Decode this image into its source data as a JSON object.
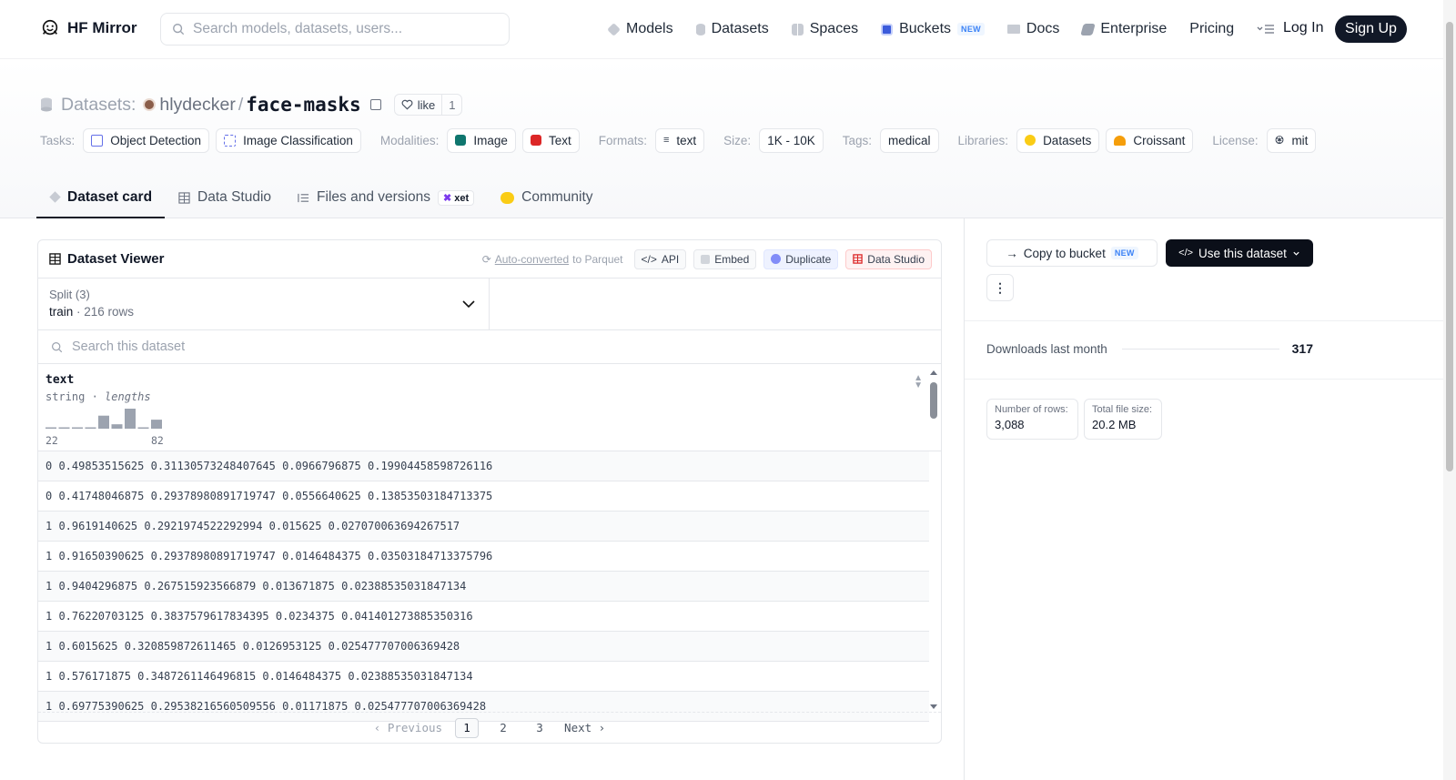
{
  "header": {
    "brand": "HF Mirror",
    "search_placeholder": "Search models, datasets, users...",
    "nav": [
      {
        "label": "Models",
        "icon": "models-icon"
      },
      {
        "label": "Datasets",
        "icon": "datasets-icon"
      },
      {
        "label": "Spaces",
        "icon": "spaces-icon"
      },
      {
        "label": "Buckets",
        "icon": "buckets-icon",
        "badge": "NEW"
      },
      {
        "label": "Docs",
        "icon": "docs-icon"
      },
      {
        "label": "Enterprise",
        "icon": "enterprise-icon"
      },
      {
        "label": "Pricing"
      }
    ],
    "login": "Log In",
    "signup": "Sign Up"
  },
  "repo": {
    "type_label": "Datasets:",
    "owner": "hlydecker",
    "name": "face-masks",
    "like_label": "like",
    "like_count": "1"
  },
  "meta": {
    "tasks_label": "Tasks:",
    "tasks": [
      "Object Detection",
      "Image Classification"
    ],
    "modalities_label": "Modalities:",
    "modalities": [
      "Image",
      "Text"
    ],
    "formats_label": "Formats:",
    "formats": [
      "text"
    ],
    "size_label": "Size:",
    "size": "1K - 10K",
    "tags_label": "Tags:",
    "tags": [
      "medical"
    ],
    "libraries_label": "Libraries:",
    "libraries": [
      "Datasets",
      "Croissant"
    ],
    "license_label": "License:",
    "license": "mit"
  },
  "tabs": [
    {
      "label": "Dataset card",
      "active": true
    },
    {
      "label": "Data Studio"
    },
    {
      "label": "Files and versions",
      "badge": "xet"
    },
    {
      "label": "Community"
    }
  ],
  "viewer": {
    "title": "Dataset Viewer",
    "auto_converted": "Auto-converted",
    "to_parquet": " to Parquet",
    "api": "API",
    "embed": "Embed",
    "duplicate": "Duplicate",
    "data_studio": "Data Studio",
    "split_label": "Split (3)",
    "split_value": "train",
    "split_rows": "216 rows",
    "search_placeholder": "Search this dataset",
    "column": {
      "name": "text",
      "type": "string",
      "lengths": "lengths",
      "min": "22",
      "max": "82"
    },
    "histogram": [
      0.05,
      0.05,
      0.05,
      0.05,
      0.65,
      0.22,
      1.0,
      0.05,
      0.45
    ],
    "rows": [
      "0 0.49853515625 0.31130573248407645 0.0966796875 0.19904458598726116",
      "0 0.41748046875 0.29378980891719747 0.0556640625 0.13853503184713375",
      "1 0.9619140625 0.2921974522292994 0.015625 0.027070063694267517",
      "1 0.91650390625 0.29378980891719747 0.0146484375 0.03503184713375796",
      "1 0.9404296875 0.267515923566879 0.013671875 0.02388535031847134",
      "1 0.76220703125 0.3837579617834395 0.0234375 0.041401273885350316",
      "1 0.6015625 0.320859872611465 0.0126953125 0.025477707006369428",
      "1 0.576171875 0.3487261146496815 0.0146484375 0.02388535031847134",
      "1 0.69775390625 0.29538216560509556 0.01171875 0.025477707006369428"
    ],
    "pager": {
      "prev": "Previous",
      "pages": [
        "1",
        "2",
        "3"
      ],
      "current": "1",
      "next": "Next"
    }
  },
  "sidebar": {
    "copy_to_bucket": "Copy to bucket",
    "copy_badge": "NEW",
    "use_dataset": "Use this dataset",
    "downloads_label": "Downloads last month",
    "downloads_value": "317",
    "rows_label": "Number of rows:",
    "rows_value": "3,088",
    "size_label": "Total file size:",
    "size_value": "20.2 MB"
  }
}
